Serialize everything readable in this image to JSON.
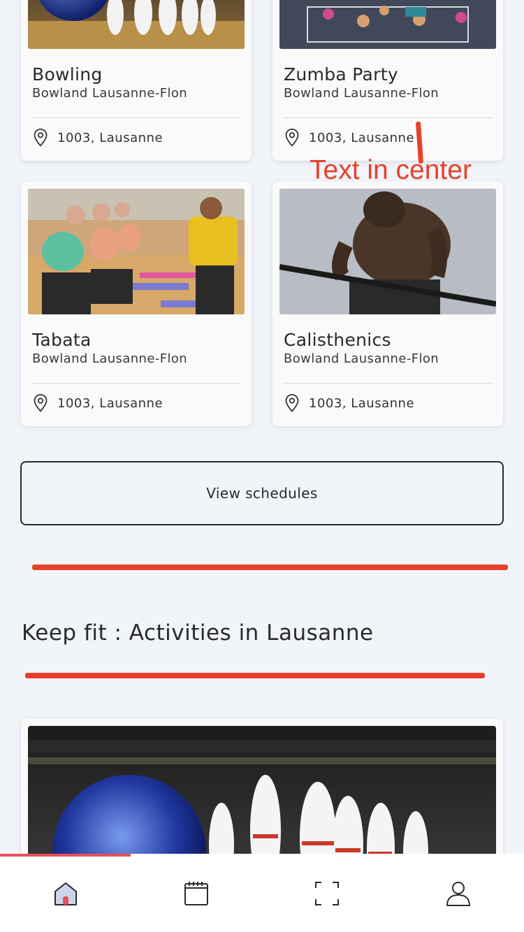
{
  "cards": [
    {
      "title": "Bowling",
      "venue": "Bowland Lausanne-Flon",
      "location": "1003, Lausanne",
      "image": "bowling-ball-and-pins-photo"
    },
    {
      "title": "Zumba Party",
      "venue": "Bowland Lausanne-Flon",
      "location": "1003, Lausanne",
      "image": "zumba-class-stage-photo"
    },
    {
      "title": "Tabata",
      "venue": "Bowland Lausanne-Flon",
      "location": "1003, Lausanne",
      "image": "fitness-class-squats-photo"
    },
    {
      "title": "Calisthenics",
      "venue": "Bowland Lausanne-Flon",
      "location": "1003, Lausanne",
      "image": "athlete-bar-dips-photo"
    }
  ],
  "view_schedules_label": "View schedules",
  "section_title": "Keep fit : Activities in Lausanne",
  "annotation_text": "Text in center",
  "annotation_color": "#e8412b",
  "featured_image": "bowling-ball-and-pins-photo",
  "tabbar": {
    "items": [
      {
        "icon": "home-icon",
        "active": true
      },
      {
        "icon": "calendar-icon",
        "active": false
      },
      {
        "icon": "scan-icon",
        "active": false
      },
      {
        "icon": "profile-icon",
        "active": false
      }
    ],
    "progress": 0.25,
    "accent": "#e8515a"
  }
}
